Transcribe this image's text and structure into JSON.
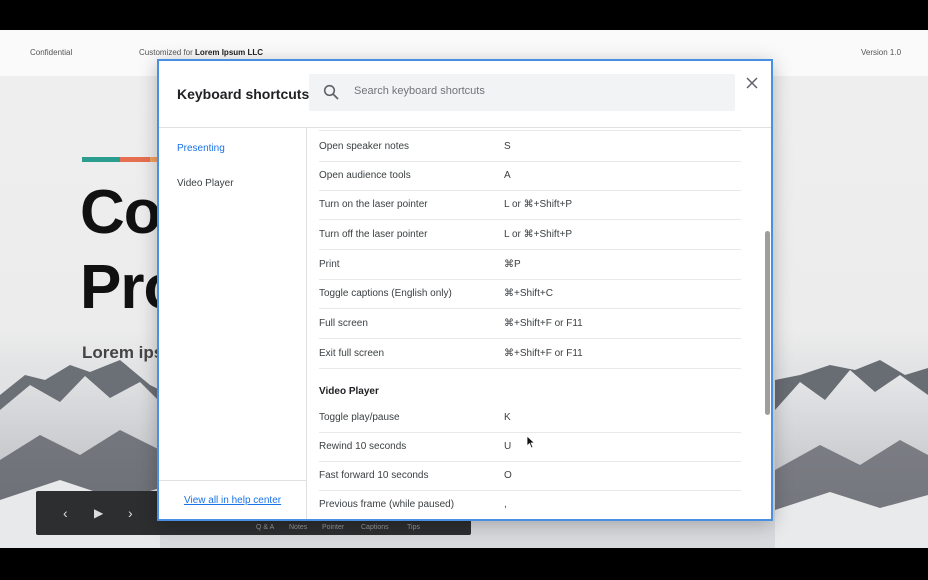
{
  "slide": {
    "header_left": "Confidential",
    "header_customized_prefix": "Customized for ",
    "header_customized_company": "Lorem Ipsum LLC",
    "header_right": "Version 1.0",
    "title_line1": "Co",
    "title_line2": "Pro",
    "subtitle": "Lorem ips",
    "accent_colors": [
      "#2a9d8f",
      "#e76f51",
      "#f4a261"
    ]
  },
  "presenter_bar": {
    "labels": [
      "Q & A",
      "Notes",
      "Pointer",
      "Captions",
      "Tips"
    ]
  },
  "dialog": {
    "title": "Keyboard shortcuts",
    "search_placeholder": "Search keyboard shortcuts",
    "sidebar": {
      "items": [
        {
          "label": "Presenting",
          "active": true
        },
        {
          "label": "Video Player",
          "active": false
        }
      ],
      "help_link": "View all in help center"
    },
    "presenting_rows": [
      {
        "name": "Open speaker notes",
        "keys": "S"
      },
      {
        "name": "Open audience tools",
        "keys": "A"
      },
      {
        "name": "Turn on the laser pointer",
        "keys": "L or ⌘+Shift+P"
      },
      {
        "name": "Turn off the laser pointer",
        "keys": "L or ⌘+Shift+P"
      },
      {
        "name": "Print",
        "keys": "⌘P"
      },
      {
        "name": "Toggle captions (English only)",
        "keys": "⌘+Shift+C"
      },
      {
        "name": "Full screen",
        "keys": "⌘+Shift+F or F11"
      },
      {
        "name": "Exit full screen",
        "keys": "⌘+Shift+F or F11"
      }
    ],
    "video_section_title": "Video Player",
    "video_rows": [
      {
        "name": "Toggle play/pause",
        "keys": "K"
      },
      {
        "name": "Rewind 10 seconds",
        "keys": "U"
      },
      {
        "name": "Fast forward 10 seconds",
        "keys": "O"
      },
      {
        "name": "Previous frame (while paused)",
        "keys": ","
      }
    ]
  }
}
